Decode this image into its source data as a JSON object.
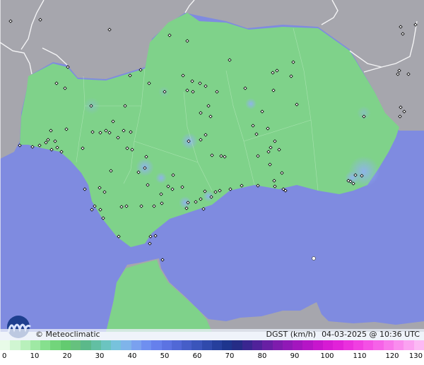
{
  "map": {
    "credit": "Meteoclimatic",
    "variable": "DGST (km/h)",
    "timestamp": "04-03-2025 @ 10:36 UTC",
    "colors": {
      "sea": "#7f8be0",
      "land_outside": "#a6a6ad",
      "land_region": "#7fd28a",
      "border": "#f4f4f6"
    }
  },
  "legend": {
    "labels": [
      "0",
      "10",
      "20",
      "30",
      "40",
      "50",
      "60",
      "70",
      "80",
      "90",
      "100",
      "110",
      "120",
      "130"
    ],
    "colors": [
      "#e8fbe8",
      "#d0f6d2",
      "#b8f0bb",
      "#9fe9a4",
      "#86e08e",
      "#72d57b",
      "#63cb70",
      "#66c17e",
      "#5bb98a",
      "#62bfa3",
      "#6bc4c0",
      "#77c2dc",
      "#7fb4ea",
      "#7aa1ef",
      "#6f8ff0",
      "#6680ec",
      "#5c73e2",
      "#5168d6",
      "#465ec8",
      "#3b55bb",
      "#304aac",
      "#263f9d",
      "#1e358e",
      "#252c86",
      "#3a2690",
      "#50229a",
      "#681fa4",
      "#7e1cad",
      "#9019b6",
      "#a316be",
      "#b515c6",
      "#c716cd",
      "#d61bd3",
      "#e122d8",
      "#ea30dd",
      "#f03fe1",
      "#f450e5",
      "#f662e8",
      "#f877eb",
      "#fa8cee",
      "#fba2f1",
      "#fcb9f4"
    ]
  }
}
